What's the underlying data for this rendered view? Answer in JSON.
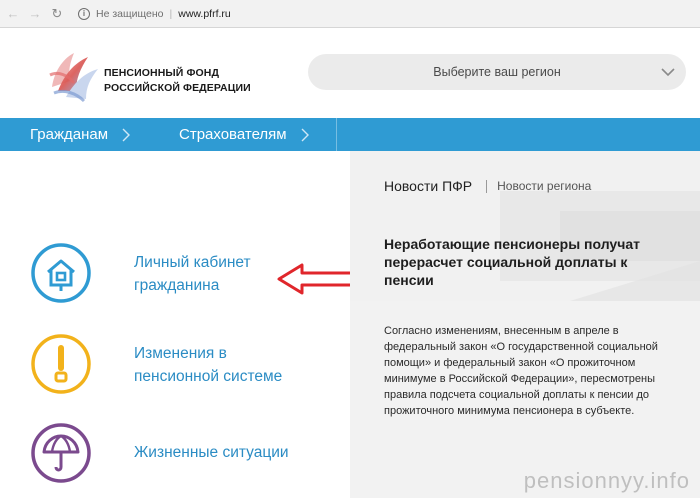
{
  "browser": {
    "back_icon": "arrow-left-icon",
    "forward_icon": "arrow-right-icon",
    "reload_icon": "reload-icon",
    "security_text": "Не защищено",
    "url": "www.pfrf.ru"
  },
  "header": {
    "logo_line1": "ПЕНСИОННЫЙ ФОНД",
    "logo_line2": "РОССИЙСКОЙ ФЕДЕРАЦИИ",
    "region_placeholder": "Выберите ваш регион"
  },
  "nav": {
    "items": [
      {
        "label": "Гражданам"
      },
      {
        "label": "Страхователям"
      }
    ]
  },
  "menu": {
    "items": [
      {
        "line1": "Личный кабинет",
        "line2": "гражданина",
        "icon": "house-icon"
      },
      {
        "line1": "Изменения в",
        "line2": "пенсионной системе",
        "icon": "exclamation-icon"
      },
      {
        "line1": "Жизненные ситуации",
        "line2": "",
        "icon": "umbrella-icon"
      }
    ]
  },
  "news": {
    "tab_active": "Новости ПФР",
    "tab_other": "Новости региона",
    "title": "Неработающие пенсионеры получат перерасчет социальной доплаты к пенсии",
    "body": "Согласно изменениям, внесенным в апреле в федеральный закон «О государственной социальной помощи» и федеральный закон «О прожиточном минимуме в Российской Федерации», пересмотрены правила подсчета социальной доплаты к пенсии до прожиточного минимума пенсионера в субъекте."
  },
  "watermark": "pensionnyy.info",
  "colors": {
    "nav_blue": "#2f9bd3",
    "link_blue": "#2b8cc4",
    "icon_blue": "#2f9bd3",
    "icon_yellow": "#f2b21b",
    "icon_purple": "#7b4a8e",
    "arrow_red": "#e0262b"
  }
}
